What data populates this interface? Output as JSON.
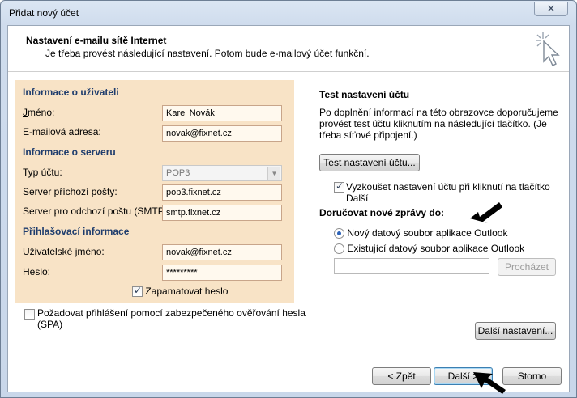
{
  "window": {
    "title": "Přidat nový účet",
    "close_glyph": "✕"
  },
  "header": {
    "title": "Nastavení e-mailu sítě Internet",
    "subtitle": "Je třeba provést následující nastavení. Potom bude e-mailový účet funkční.",
    "icon": "wizard-sparkle-cursor-icon"
  },
  "user_info": {
    "heading": "Informace o uživateli",
    "name_label": "Jméno:",
    "name_value": "Karel Novák",
    "email_label": "E-mailová adresa:",
    "email_value": "novak@fixnet.cz"
  },
  "server_info": {
    "heading": "Informace o serveru",
    "account_type_label": "Typ účtu:",
    "account_type_value": "POP3",
    "incoming_label": "Server příchozí pošty:",
    "incoming_value": "pop3.fixnet.cz",
    "outgoing_label": "Server pro odchozí poštu (SMTP):",
    "outgoing_value": "smtp.fixnet.cz"
  },
  "login_info": {
    "heading": "Přihlašovací informace",
    "username_label": "Uživatelské jméno:",
    "username_value": "novak@fixnet.cz",
    "password_label": "Heslo:",
    "password_value": "*********",
    "remember_label": "Zapamatovat heslo",
    "remember_checked": true
  },
  "spa": {
    "label_line1": "Požadovat přihlášení pomocí zabezpečeného ověřování hesla",
    "label_line2": "(SPA)",
    "checked": false
  },
  "test": {
    "heading": "Test nastavení účtu",
    "description": "Po doplnění informací na této obrazovce doporučujeme provést test účtu kliknutím na následující tlačítko. (Je třeba síťové připojení.)",
    "button_label": "Test nastavení účtu...",
    "auto_test_line1": "Vyzkoušet nastavení účtu při kliknutí na tlačítko",
    "auto_test_line2": "Další",
    "auto_test_checked": true
  },
  "deliver": {
    "heading": "Doručovat nové zprávy do:",
    "option_new": "Nový datový soubor aplikace Outlook",
    "option_existing": "Existující datový soubor aplikace Outlook",
    "selected": "option_new",
    "browse_label": "Procházet"
  },
  "more_settings_label": "Další nastavení...",
  "footer": {
    "back_label": "< Zpět",
    "next_label": "Další >",
    "cancel_label": "Storno"
  }
}
